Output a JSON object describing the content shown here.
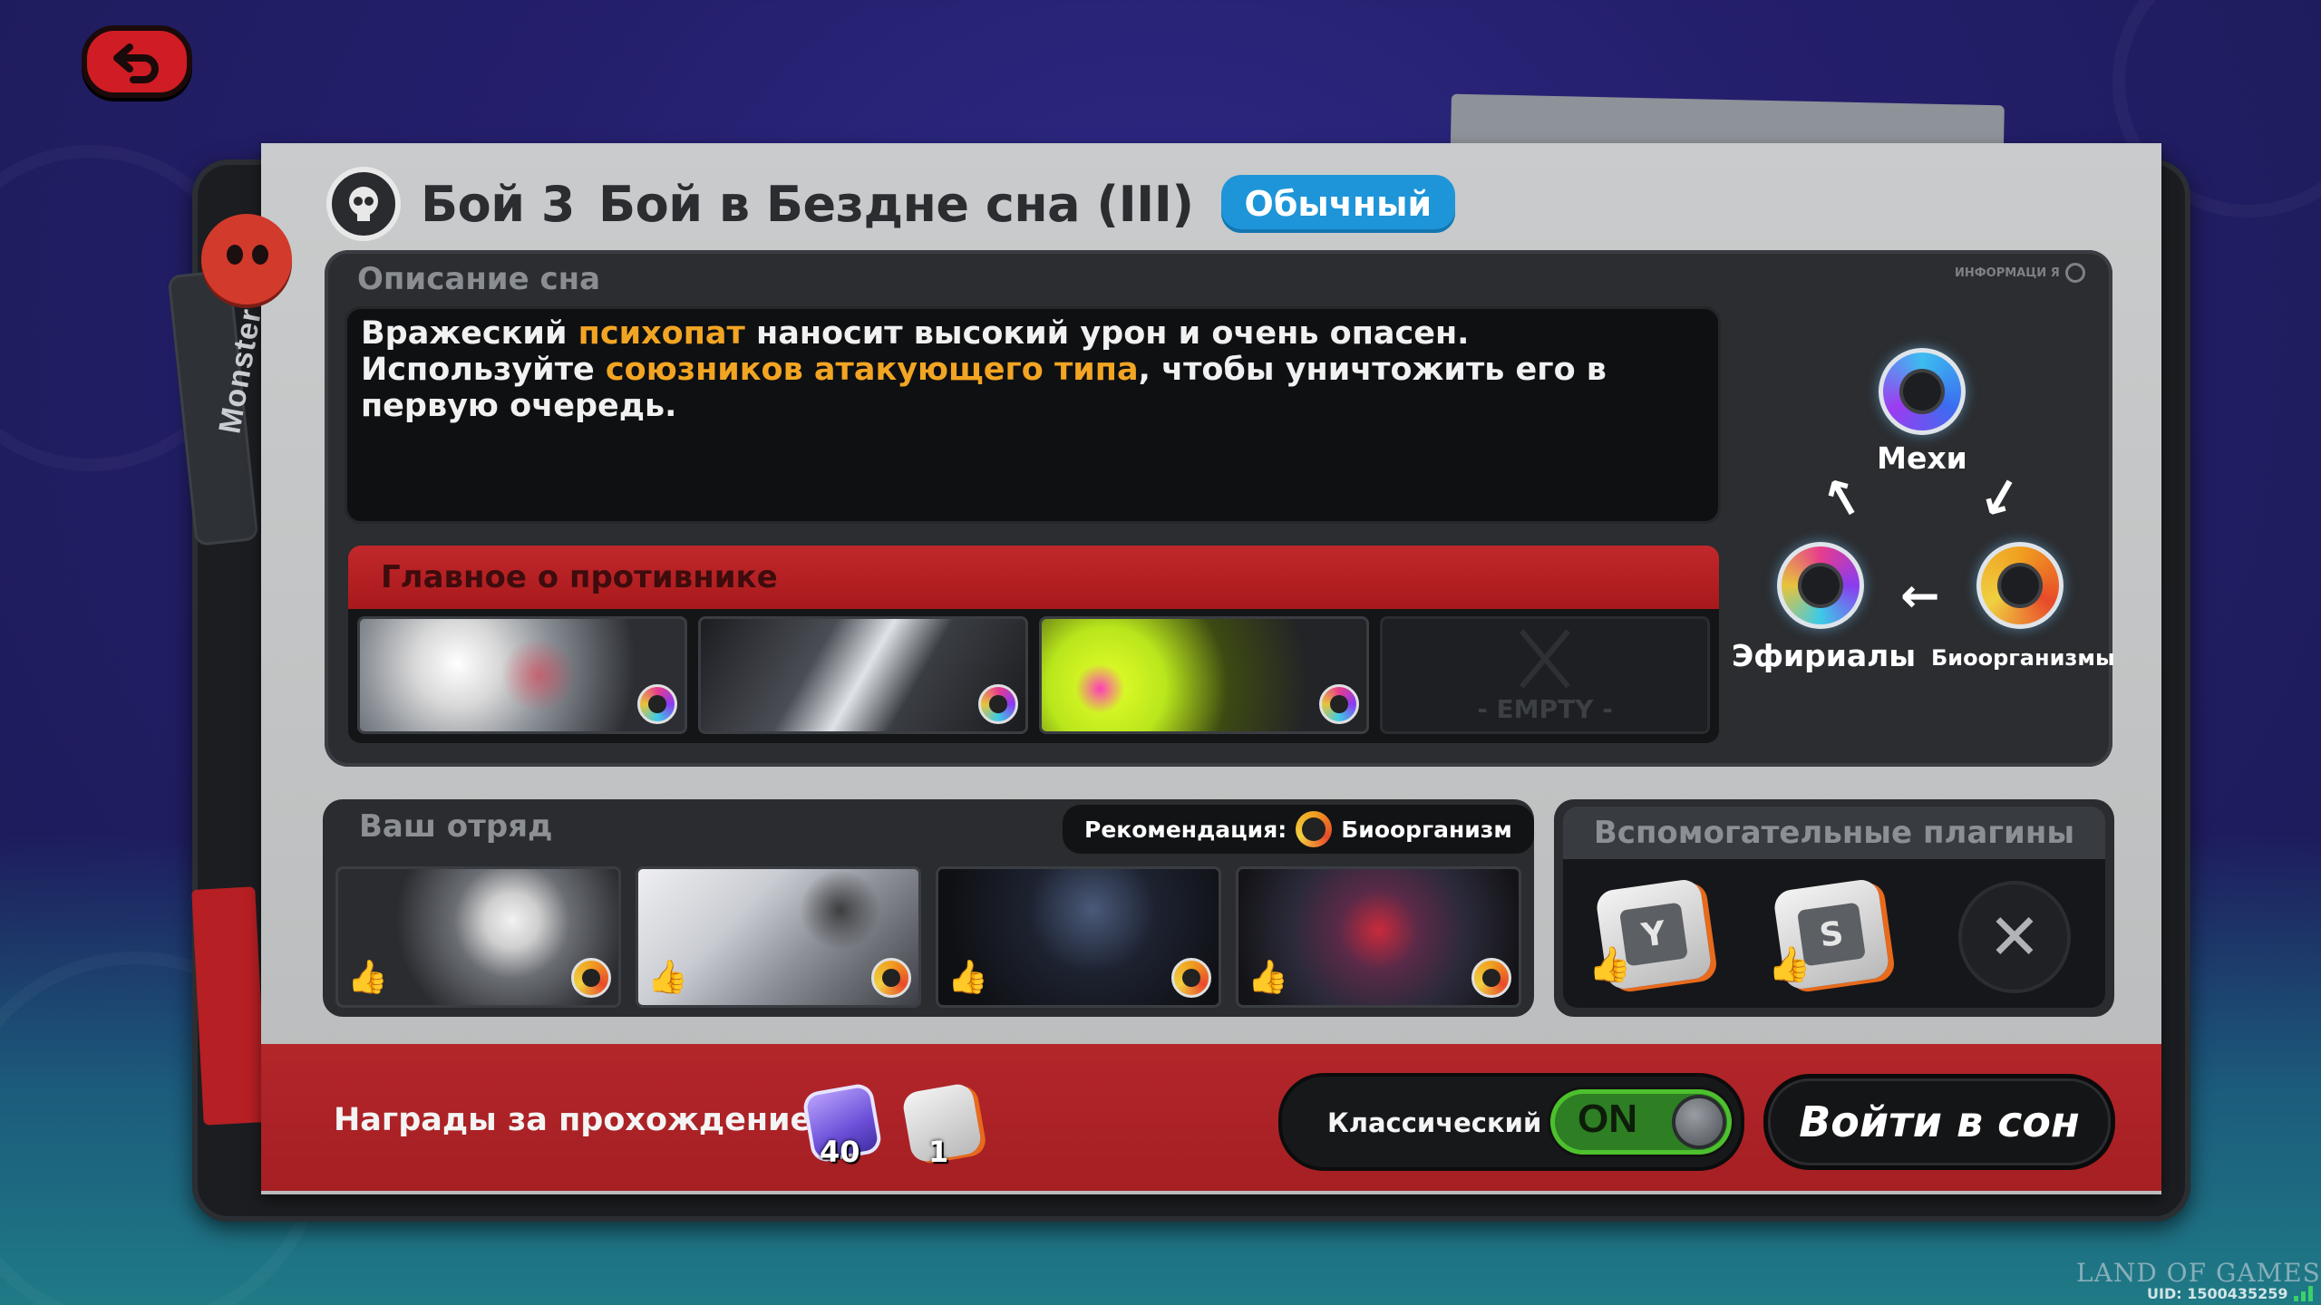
{
  "header": {
    "battle_number": "Бой 3",
    "battle_name": "Бой в Бездне сна (III)",
    "difficulty_badge": "Обычный"
  },
  "description": {
    "section_label": "Описание сна",
    "info_mini_label": "ИНФОРМАЦИ Я",
    "text_part1": "Вражеский ",
    "text_highlight1": "психопат",
    "text_part2": " наносит высокий урон и очень опасен. Используйте ",
    "text_highlight2": "союзников атакующего типа",
    "text_part3": ", чтобы уничтожить его в первую очередь."
  },
  "enemies": {
    "header": "Главное о противнике",
    "slots": [
      {
        "name": "enemy-1",
        "faction": "ethereal"
      },
      {
        "name": "enemy-2",
        "faction": "ethereal"
      },
      {
        "name": "enemy-3",
        "faction": "ethereal"
      }
    ],
    "empty_label": "- EMPTY -"
  },
  "factions": {
    "mech": "Мехи",
    "ethereal": "Эфириалы",
    "bio": "Биоорганизмы"
  },
  "squad": {
    "label": "Ваш отряд",
    "recommendation_label": "Рекомендация:",
    "recommendation_value": "Биоорганизм",
    "members": [
      {
        "faction": "bio"
      },
      {
        "faction": "bio"
      },
      {
        "faction": "bio"
      },
      {
        "faction": "bio"
      }
    ]
  },
  "plugins": {
    "header": "Вспомогательные плагины",
    "slots": [
      "Y",
      "S"
    ]
  },
  "rewards": {
    "label": "Награды за прохождение:",
    "items": [
      {
        "icon": "dream-gem-icon",
        "count": "40"
      },
      {
        "icon": "plugin-cube-icon",
        "count": "1"
      }
    ]
  },
  "mode": {
    "label": "Классический",
    "toggle_state": "ON"
  },
  "enter_button": "Войти в сон",
  "watermark": "LAND OF GAMES",
  "uid": "UID: 1500435259",
  "strap_text": "Monster",
  "colors": {
    "accent_orange": "#f2a523",
    "badge_blue": "#1e95d8",
    "toggle_green": "#4dc02e",
    "red_band": "#b3262a"
  }
}
